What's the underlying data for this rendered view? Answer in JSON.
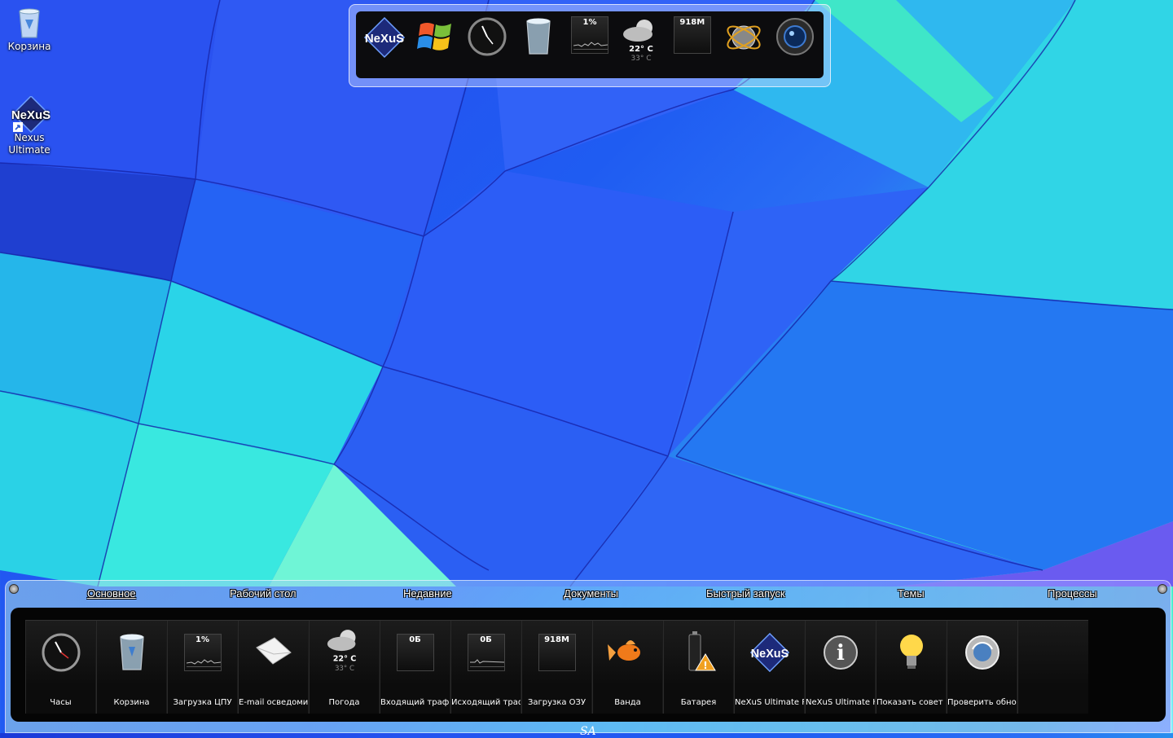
{
  "desktop": {
    "icons": [
      {
        "label": "Корзина",
        "icon": "recycle-bin-icon"
      },
      {
        "label": "Nexus Ultimate",
        "icon": "nexus-logo-icon"
      }
    ]
  },
  "top_dock": {
    "items": [
      {
        "icon": "nexus-logo-icon",
        "text": "NeXuS"
      },
      {
        "icon": "windows-logo-icon",
        "text": ""
      },
      {
        "icon": "clock-icon",
        "text": ""
      },
      {
        "icon": "recycle-bin-icon",
        "text": ""
      },
      {
        "icon": "cpu-monitor-icon",
        "text": "1%"
      },
      {
        "icon": "weather-icon",
        "text": "22° C",
        "subtext": "33° C"
      },
      {
        "icon": "ram-monitor-icon",
        "text": "918M"
      },
      {
        "icon": "globe-network-icon",
        "text": ""
      },
      {
        "icon": "camera-lens-icon",
        "text": ""
      }
    ]
  },
  "bottom_bar": {
    "tabs": [
      "Основное",
      "Рабочий стол",
      "Недавние",
      "Документы",
      "Быстрый запуск",
      "Темы",
      "Процессы"
    ],
    "active_tab": "Основное",
    "items": [
      {
        "label": "Часы",
        "icon": "clock-icon",
        "value": ""
      },
      {
        "label": "Корзина",
        "icon": "recycle-bin-icon",
        "value": ""
      },
      {
        "label": "Загрузка ЦПУ",
        "icon": "cpu-monitor-icon",
        "value": "1%"
      },
      {
        "label": "E-mail осведомит",
        "icon": "envelope-icon",
        "value": ""
      },
      {
        "label": "Погода",
        "icon": "weather-icon",
        "value": "22° C",
        "subvalue": "33° C"
      },
      {
        "label": "Входящий трафи",
        "icon": "network-in-monitor-icon",
        "value": "0Б"
      },
      {
        "label": "Исходящий траф",
        "icon": "network-out-monitor-icon",
        "value": "0Б"
      },
      {
        "label": "Загрузка ОЗУ",
        "icon": "ram-monitor-icon",
        "value": "918M"
      },
      {
        "label": "Ванда",
        "icon": "goldfish-icon",
        "value": ""
      },
      {
        "label": "Батарея",
        "icon": "battery-warning-icon",
        "value": ""
      },
      {
        "label": "NeXuS Ultimate Pr",
        "icon": "nexus-logo-icon",
        "value": "NeXuS"
      },
      {
        "label": "NeXuS Ultimate H",
        "icon": "info-icon",
        "value": ""
      },
      {
        "label": "Показать совет д",
        "icon": "lightbulb-icon",
        "value": ""
      },
      {
        "label": "Проверить обнов",
        "icon": "update-globe-icon",
        "value": ""
      }
    ],
    "signature": "SA"
  },
  "colors": {
    "wall_blue": "#2453f0",
    "wall_cyan": "#2ee0d6",
    "panel_dark": "#050505"
  }
}
